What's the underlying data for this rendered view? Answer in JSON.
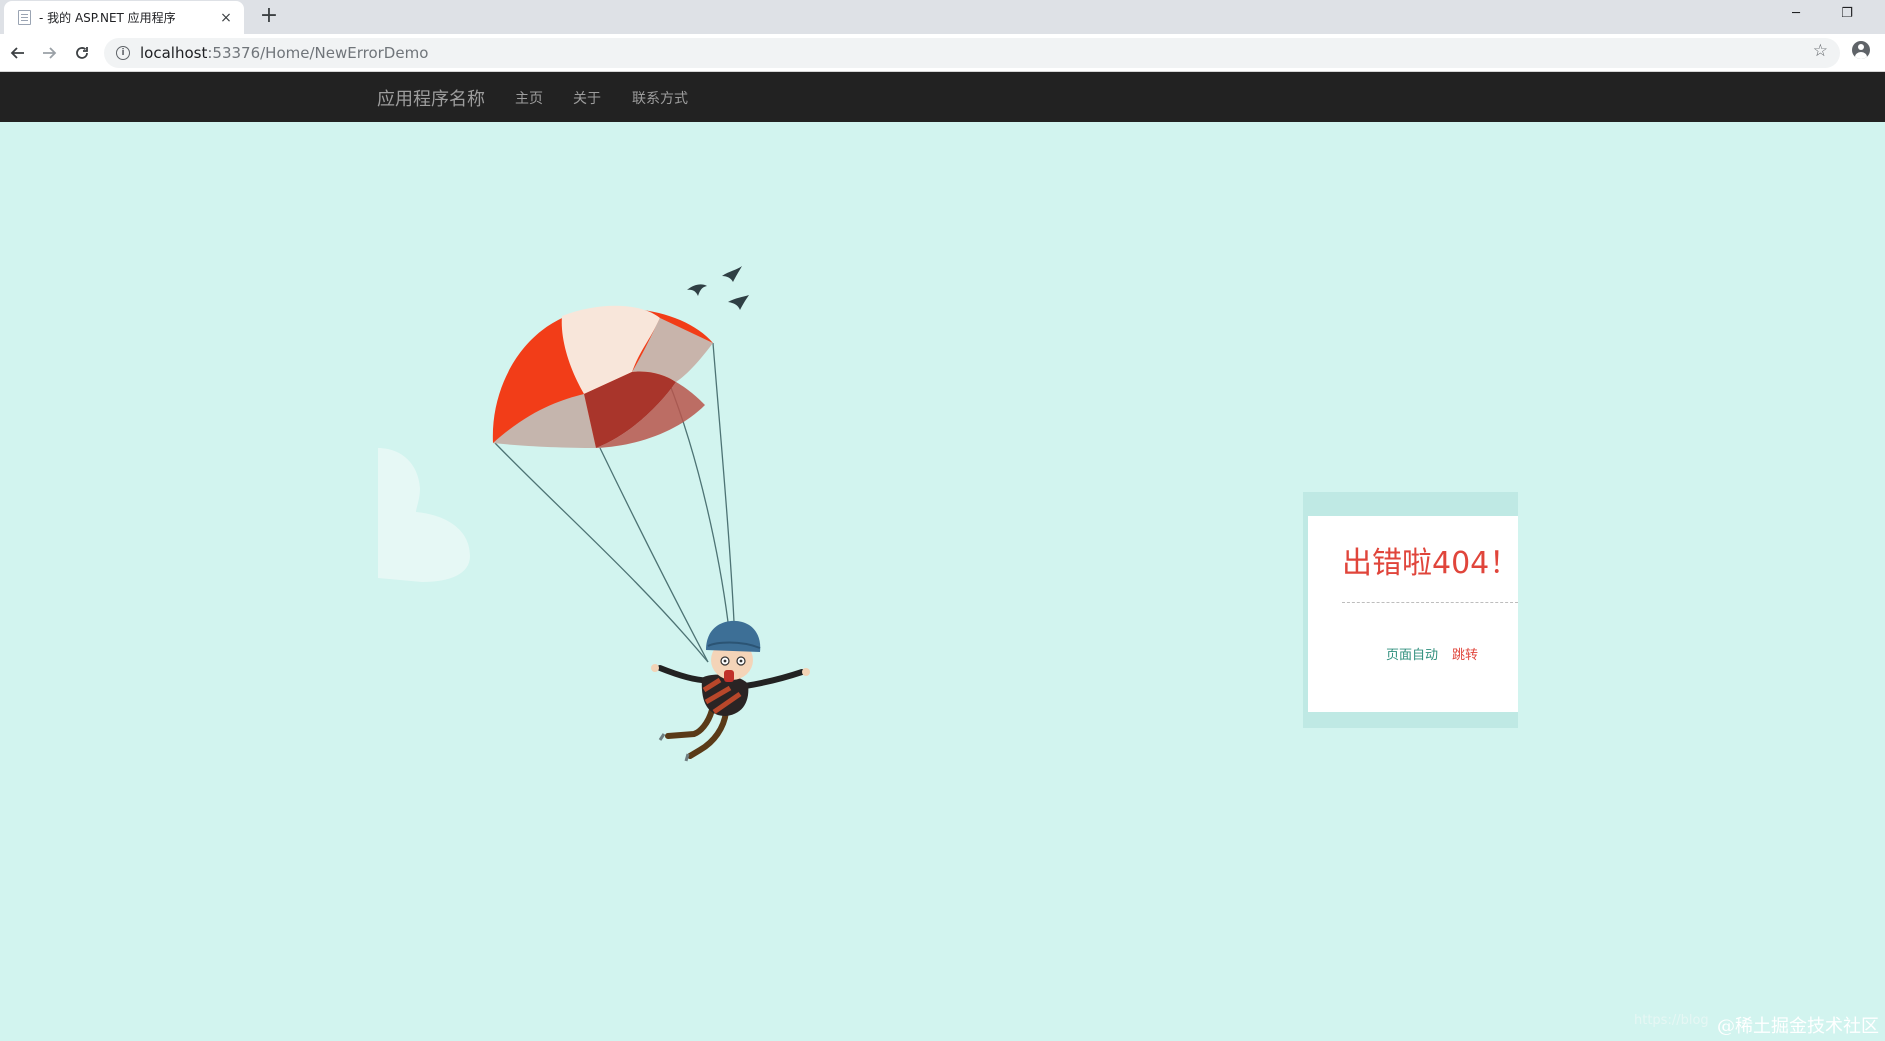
{
  "browser": {
    "tab_title": "- 我的 ASP.NET 应用程序",
    "tab_close": "×",
    "new_tab": "+",
    "url_host": "localhost",
    "url_path": ":53376/Home/NewErrorDemo",
    "window_controls": {
      "minimize": "─",
      "restore": "❐"
    },
    "icons": [
      "back-icon",
      "forward-icon",
      "reload-icon",
      "info-icon",
      "star-icon",
      "profile-icon"
    ]
  },
  "navbar": {
    "brand": "应用程序名称",
    "links": [
      "主页",
      "关于",
      "联系方式"
    ]
  },
  "error_card": {
    "title": "出错啦404！",
    "auto_text": "页面自动",
    "jump_link": "跳转"
  },
  "watermark": {
    "blog": "https://blog",
    "site": "@稀土掘金技术社区"
  },
  "colors": {
    "page_background": "#d2f4ef",
    "navbar": "#222222",
    "error_title": "#e0453b",
    "auto_text": "#2f8f7d",
    "parachute_red": "#f03b1a",
    "helmet": "#3d6f96"
  }
}
